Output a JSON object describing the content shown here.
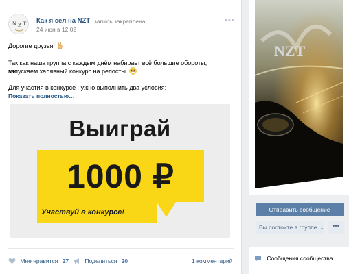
{
  "post": {
    "author": "Как я сел на NZT",
    "pinned_label": "запись закреплена",
    "date": "24 июн в 12:02",
    "more_icon": "•••",
    "greeting": "Дорогие друзья!",
    "para1_line1": "Так как наша группа с каждым днём набирает всё большие обороты, мы",
    "para1_line2": "запускаем халявный конкурс на репосты.",
    "para2": "Для участия в конкурсе нужно выполнить два условия:",
    "show_more": "Показать полностью…",
    "image": {
      "title": "Выиграй",
      "amount": "1000 ₽",
      "subtitle": "Участвуй в конкурсе!",
      "accent_color": "#f9d716"
    },
    "footer": {
      "like_label": "Мне нравится",
      "like_count": "27",
      "share_label": "Поделиться",
      "share_count": "20",
      "comments_label": "1 комментарий"
    }
  },
  "sidebar": {
    "cover_text": "NZT",
    "send_message": "Отправить сообщение",
    "membership": "Вы состоите в группе",
    "membership_chevron": "⌄",
    "more_button": "•••",
    "community_messages": "Сообщения сообщества",
    "button_color": "#5b7fa6"
  }
}
